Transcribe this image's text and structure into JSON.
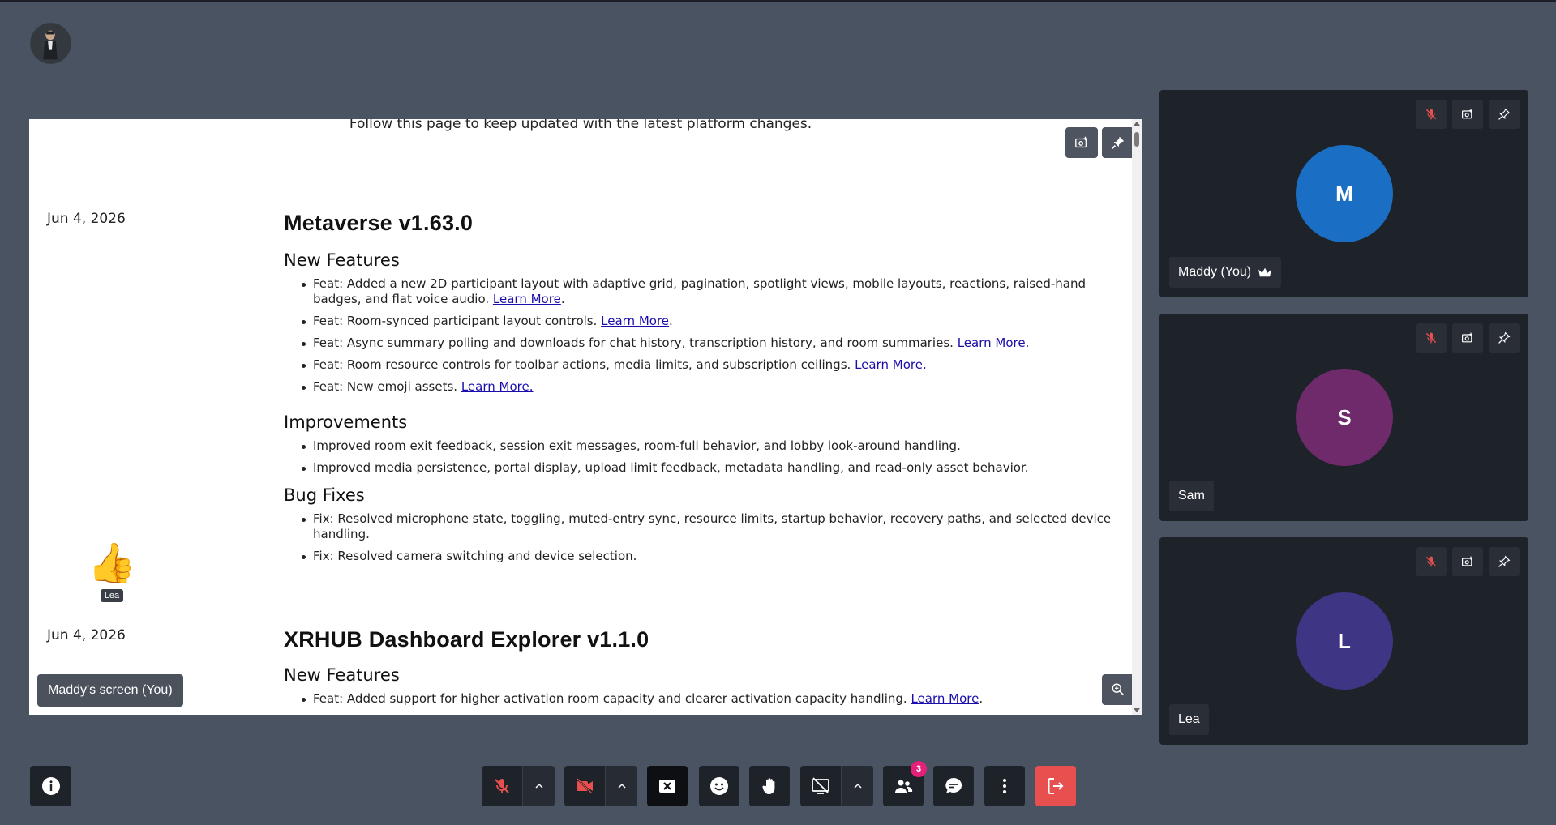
{
  "shared_screen": {
    "follow_text": "Follow this page to keep updated with the latest platform changes.",
    "label": "Maddy's screen (You)",
    "entries": [
      {
        "date": "Jun 4, 2026",
        "title": "Metaverse v1.63.0",
        "sections": [
          {
            "heading": "New Features",
            "items": [
              {
                "text": "Feat: Added a new 2D participant layout with adaptive grid, pagination, spotlight views, mobile layouts, reactions, raised-hand badges, and flat voice audio. ",
                "link": "Learn More",
                "after": "."
              },
              {
                "text": "Feat: Room-synced participant layout controls. ",
                "link": "Learn More",
                "after": "."
              },
              {
                "text": "Feat: Async summary polling and downloads for chat history, transcription history, and room summaries. ",
                "link": "Learn More.",
                "after": ""
              },
              {
                "text": "Feat: Room resource controls for toolbar actions, media limits, and subscription ceilings. ",
                "link": "Learn More.",
                "after": ""
              },
              {
                "text": "Feat: New emoji assets. ",
                "link": "Learn More.",
                "after": ""
              }
            ]
          },
          {
            "heading": "Improvements",
            "items": [
              {
                "text": "Improved room exit feedback, session exit messages, room-full behavior, and lobby look-around handling.",
                "link": "",
                "after": ""
              },
              {
                "text": "Improved media persistence, portal display, upload limit feedback, metadata handling, and read-only asset behavior.",
                "link": "",
                "after": ""
              }
            ]
          },
          {
            "heading": "Bug Fixes",
            "items": [
              {
                "text": "Fix: Resolved microphone state, toggling, muted-entry sync, resource limits, startup behavior, recovery paths, and selected device handling.",
                "link": "",
                "after": ""
              },
              {
                "text": "Fix: Resolved camera switching and device selection.",
                "link": "",
                "after": ""
              }
            ]
          }
        ]
      },
      {
        "date": "Jun 4, 2026",
        "title": "XRHUB Dashboard Explorer v1.1.0",
        "sections": [
          {
            "heading": "New Features",
            "items": [
              {
                "text": "Feat: Added support for higher activation room capacity and clearer activation capacity handling. ",
                "link": "Learn More",
                "after": "."
              }
            ]
          }
        ]
      }
    ],
    "reaction": {
      "emoji": "👍",
      "user": "Lea"
    }
  },
  "participants": [
    {
      "initial": "M",
      "name": "Maddy (You)",
      "color": "#1a6fc4",
      "host": true
    },
    {
      "initial": "S",
      "name": "Sam",
      "color": "#6e2a6b",
      "host": false
    },
    {
      "initial": "L",
      "name": "Lea",
      "color": "#3f3585",
      "host": false
    }
  ],
  "toolbar": {
    "participants_count": "3",
    "leave_color": "#e8504f"
  }
}
